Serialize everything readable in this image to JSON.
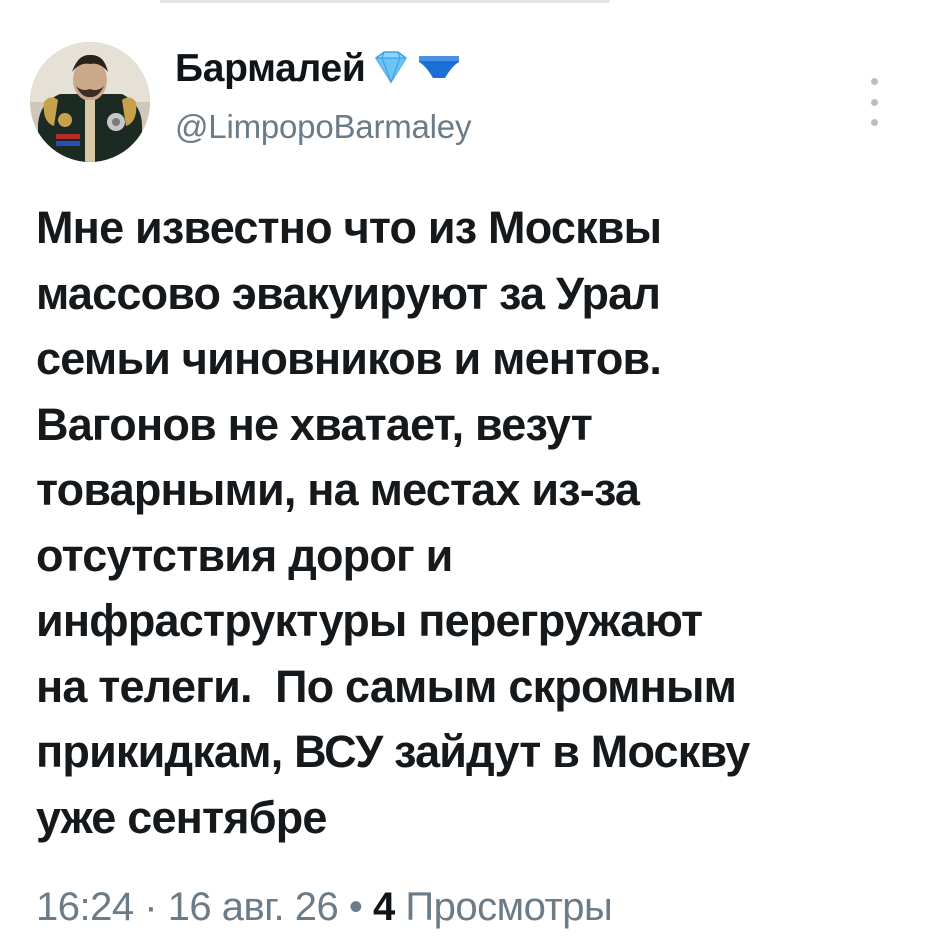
{
  "author": {
    "display_name": "Бармалей",
    "handle": "@LimpopoBarmaley",
    "badges": [
      "diamond-icon",
      "underwear-icon"
    ]
  },
  "tweet": {
    "text": "Мне известно что из Москвы\nмассово эвакуируют за Урал\nсемьи чиновников и ментов.\nВагонов не хватает, везут\nтоварными, на местах из-за\nотсутствия дорог и\nинфраструктуры перегружают\nна телеги.  По самым скромным\nприкидкам, ВСУ зайдут в Москву\nуже сентябре"
  },
  "meta": {
    "time": "16:24",
    "separator_1": "·",
    "date": "16 авг. 26",
    "separator_2": "•",
    "views_count": "4",
    "views_label": "Просмотры"
  },
  "colors": {
    "text": "#0f1419",
    "secondary": "#6b7b88",
    "diamond": "#58b7f0",
    "underwear": "#1c6fd6"
  }
}
